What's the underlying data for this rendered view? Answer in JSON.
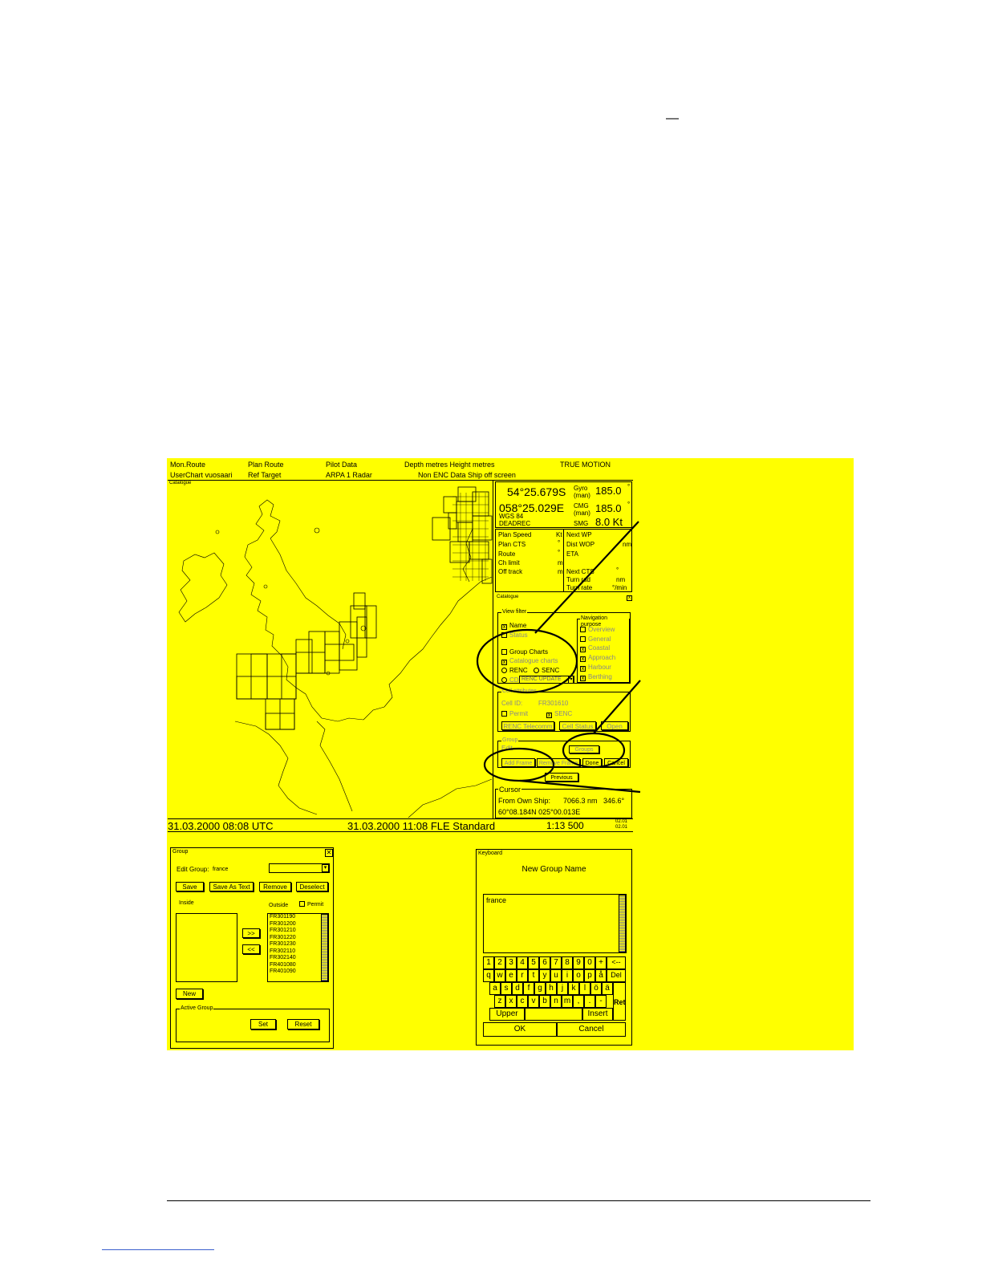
{
  "page_mark": "—",
  "status_bar": {
    "row1": [
      "Mon.Route",
      "Plan Route",
      "Pilot Data",
      "Depth metres  Height metres",
      "TRUE MOTION"
    ],
    "row2": [
      "UserChart  vuosaari",
      "Ref Target",
      "ARPA 1   Radar",
      "Non ENC Data   Ship off screen"
    ]
  },
  "chart_area": {
    "label": "Catalogue"
  },
  "position_panel": {
    "lat": "54°25.679S",
    "lon": "058°25.029E",
    "datum": "WGS 84",
    "mode": "DEADREC",
    "gyro_label": "Gyro",
    "gyro_sub": "(man)",
    "gyro_value": "185.0",
    "cmg_label": "CMG",
    "cmg_sub": "(man)",
    "cmg_value": "185.0",
    "smg_label": "SMG",
    "smg_value": "8.0 Kt",
    "deg": "°"
  },
  "route_panel": {
    "left": [
      "Plan Speed",
      "Plan CTS",
      "Route",
      "Ch limit",
      "Off track"
    ],
    "left_units": [
      "Kt",
      "°",
      "°",
      "m",
      "m"
    ],
    "right": [
      "Next WP",
      "Dist WOP",
      "ETA",
      "",
      "Next CTS",
      "Turn rad",
      "Turn rate"
    ],
    "right_units": [
      "",
      "nm",
      "",
      "",
      "°",
      "nm",
      "°/min"
    ]
  },
  "catalogue_panel": {
    "title": "Catalogue",
    "view_legend": "View filter",
    "name": "Name",
    "item2": "Status",
    "group_charts": "Group Charts",
    "catalogue_charts": "Catalogue charts",
    "renc": "RENC",
    "senc": "SENC",
    "cd": "CD",
    "dropdown": "RENC  UPDATE",
    "nav_legend": "Navigation purpose",
    "nav": [
      "Overview",
      "General",
      "Coastal",
      "Approach",
      "Harbour",
      "Berthing"
    ],
    "cell_legend": "Cell attributes",
    "cell_id_label": "Cell ID:",
    "cell_id": "FR301610",
    "permit": "Permit",
    "senc_cb": "SENC",
    "renc_tele": "RENC Telecomm",
    "cell_status": "Cell Status",
    "open": "Open",
    "group_legend": "Group",
    "edit_label": "Edit",
    "groups": "Groups",
    "add_frame": "Add Frame",
    "remove_frame": "Remove Frame",
    "done": "Done",
    "cancel": "Cancel",
    "previous": "Previous"
  },
  "cursor_panel": {
    "legend": "Cursor",
    "from_label": "From Own Ship:",
    "distance": "7066.3 nm",
    "bearing": "346.6°",
    "position": "60°08.184N   025°00.013E"
  },
  "bottom_bar": {
    "utc": "31.03.2000 08:08 UTC",
    "local": "31.03.2000 11:08 FLE Standard",
    "scale": "1:13 500",
    "ver1": "02.01",
    "ver2": "02.01"
  },
  "group_dialog": {
    "title": "Group",
    "close": "✕",
    "edit_group_label": "Edit Group:",
    "edit_group_value": "france",
    "save": "Save",
    "save_as_text": "Save As Text",
    "remove": "Remove",
    "deselect": "Deselect",
    "inside": "Inside",
    "outside": "Outside",
    "permit": "Permit",
    "move_right": ">>",
    "move_left": "<<",
    "outside_items": [
      "FR301190",
      "FR301200",
      "FR301210",
      "FR301220",
      "FR301230",
      "FR302110",
      "FR302140",
      "FR401080",
      "FR401090"
    ],
    "new": "New",
    "active_group": "Active Group",
    "set": "Set",
    "reset": "Reset"
  },
  "keyboard_dialog": {
    "title": "Keyboard",
    "heading": "New Group Name",
    "text": "france",
    "row1": [
      "1",
      "2",
      "3",
      "4",
      "5",
      "6",
      "7",
      "8",
      "9",
      "0",
      "+",
      "<--"
    ],
    "row2": [
      "q",
      "w",
      "e",
      "r",
      "t",
      "y",
      "u",
      "i",
      "o",
      "p",
      "å",
      "Del"
    ],
    "row3": [
      "a",
      "s",
      "d",
      "f",
      "g",
      "h",
      "j",
      "k",
      "l",
      "ö",
      "ä"
    ],
    "row4": [
      "z",
      "x",
      "c",
      "v",
      "b",
      "n",
      "m",
      ",",
      ".",
      "-"
    ],
    "ret": "Ret",
    "upper": "Upper",
    "insert": "Insert",
    "ok": "OK",
    "cancel": "Cancel"
  }
}
